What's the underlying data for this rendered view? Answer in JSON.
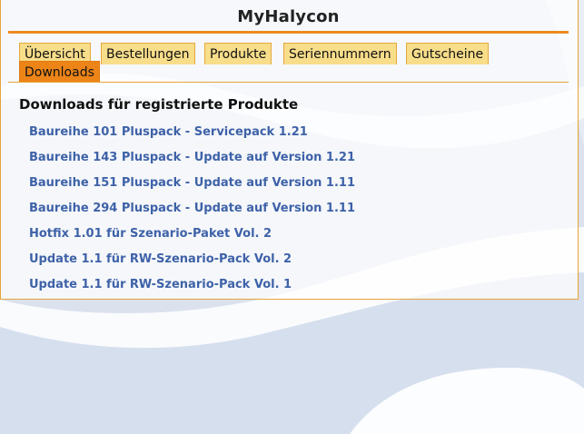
{
  "header": {
    "title": "MyHalycon"
  },
  "tabs": [
    {
      "label": "Übersicht",
      "active": false
    },
    {
      "label": "Bestellungen",
      "active": false
    },
    {
      "label": "Produkte",
      "active": false
    },
    {
      "label": "Seriennummern",
      "active": false
    },
    {
      "label": "Gutscheine",
      "active": false
    },
    {
      "label": "Downloads",
      "active": true
    }
  ],
  "downloads": {
    "title": "Downloads für registrierte Produkte",
    "items": [
      {
        "label": "Baureihe 101 Pluspack - Servicepack 1.21"
      },
      {
        "label": "Baureihe 143 Pluspack - Update auf Version 1.21"
      },
      {
        "label": "Baureihe 151 Pluspack - Update auf Version 1.11"
      },
      {
        "label": "Baureihe 294 Pluspack - Update auf Version 1.11"
      },
      {
        "label": "Hotfix 1.01 für Szenario-Paket Vol. 2"
      },
      {
        "label": "Update 1.1 für RW-Szenario-Pack Vol. 2"
      },
      {
        "label": "Update 1.1 für RW-Szenario-Pack Vol. 1"
      }
    ]
  },
  "colors": {
    "accent": "#ee8a1f",
    "tab_background": "#f8dd8a",
    "active_tab": "#ec8418",
    "link": "#3e62a8"
  }
}
